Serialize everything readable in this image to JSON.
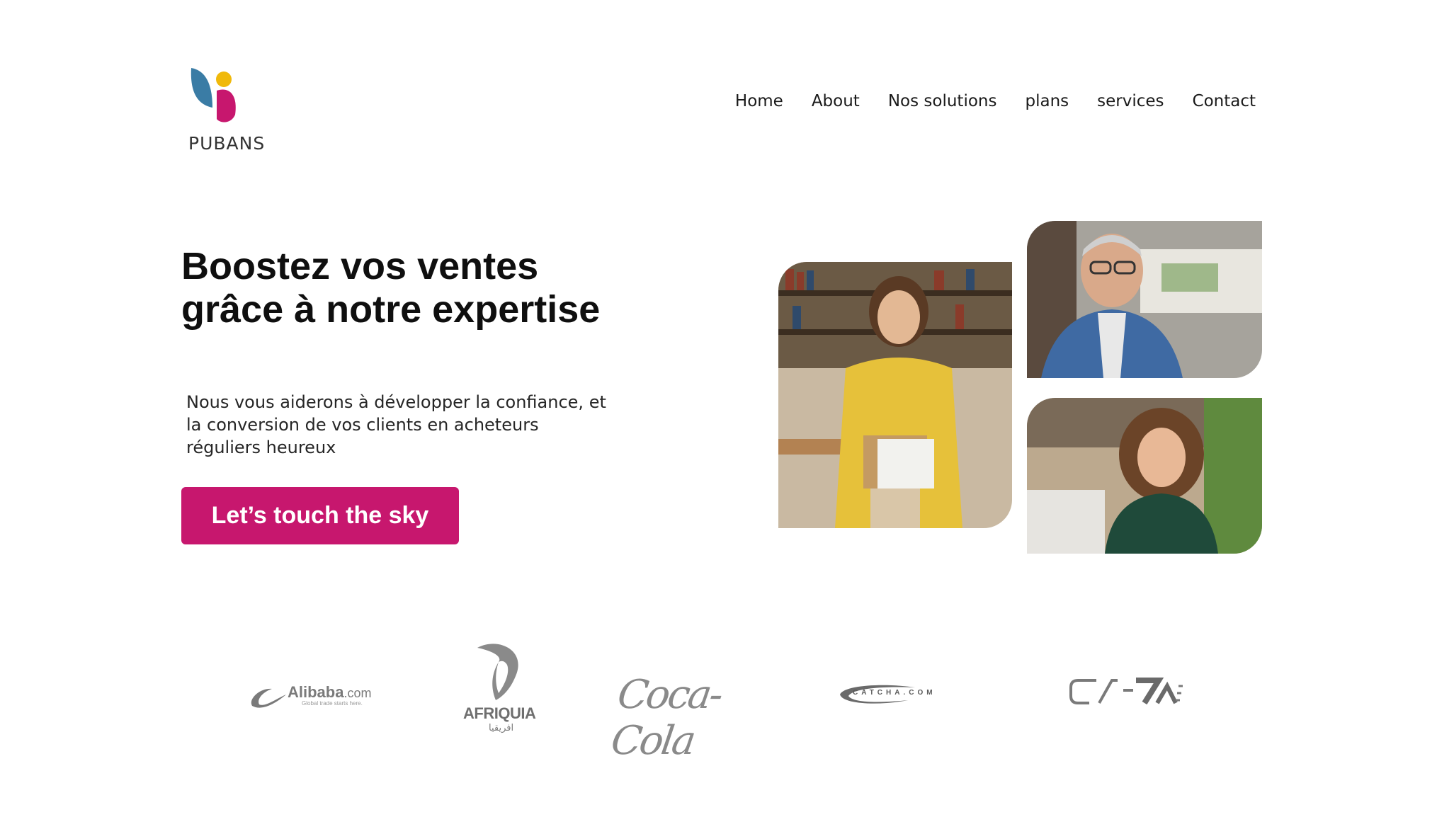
{
  "brand": {
    "name": "PUBANS",
    "colors": {
      "blue": "#3a7ca5",
      "yellow": "#f0b90b",
      "magenta": "#c7176e"
    }
  },
  "nav": {
    "items": [
      "Home",
      "About",
      "Nos solutions",
      "plans",
      "services",
      "Contact"
    ]
  },
  "hero": {
    "headline": "Boostez vos ventes grâce à notre expertise",
    "subtitle": "Nous vous aiderons à développer la confiance, et la conversion de vos clients en acheteurs réguliers heureux",
    "cta_label": "Let’s touch the sky",
    "cta_color": "#c7176e"
  },
  "photos": [
    {
      "icon": "woman-yellow-shirt-photo"
    },
    {
      "icon": "man-glasses-photo"
    },
    {
      "icon": "woman-curly-hair-photo"
    }
  ],
  "partners": {
    "alibaba": {
      "word": "Alibaba",
      "suffix": ".com",
      "tagline": "Global trade starts here."
    },
    "afriquia": {
      "word": "AFRIQUIA",
      "arabic": "افريقيا"
    },
    "cocacola": {
      "word": "Coca-Cola"
    },
    "catcha": {
      "word": "CATCHA.COM"
    },
    "ctm": {
      "word": "CTM"
    }
  }
}
